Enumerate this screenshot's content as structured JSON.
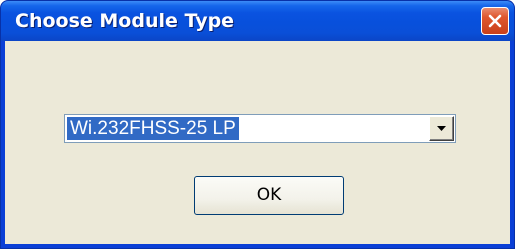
{
  "window": {
    "title": "Choose Module Type"
  },
  "module_select": {
    "selected": "Wi.232FHSS-25 LP"
  },
  "buttons": {
    "ok_label": "OK"
  },
  "icons": {
    "close": "close-icon",
    "dropdown": "chevron-down-icon"
  },
  "colors": {
    "titlebar": "#0a53e0",
    "close_button": "#e0582f",
    "dialog_background": "#ece9d8",
    "selection_highlight": "#316ac5"
  }
}
